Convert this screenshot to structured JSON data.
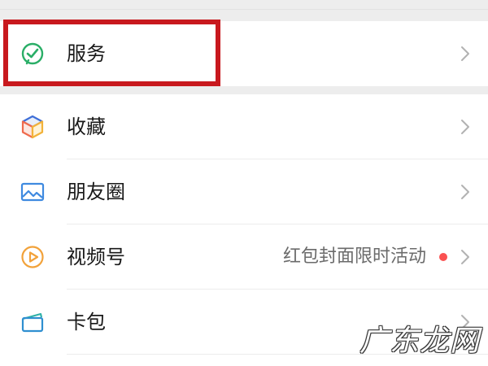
{
  "menu": {
    "items": [
      {
        "label": "服务",
        "icon": "service-check-icon"
      },
      {
        "label": "收藏",
        "icon": "favorites-cube-icon"
      },
      {
        "label": "朋友圈",
        "icon": "moments-picture-icon"
      },
      {
        "label": "视频号",
        "icon": "channels-play-icon",
        "hint": "红包封面限时活动",
        "badge": "red-dot"
      },
      {
        "label": "卡包",
        "icon": "card-wallet-icon"
      }
    ]
  },
  "watermark": "广东龙网",
  "colors": {
    "background": "#ededed",
    "highlight": "#c8191e",
    "service_icon": "#2aae67",
    "badge": "#fa5151"
  }
}
